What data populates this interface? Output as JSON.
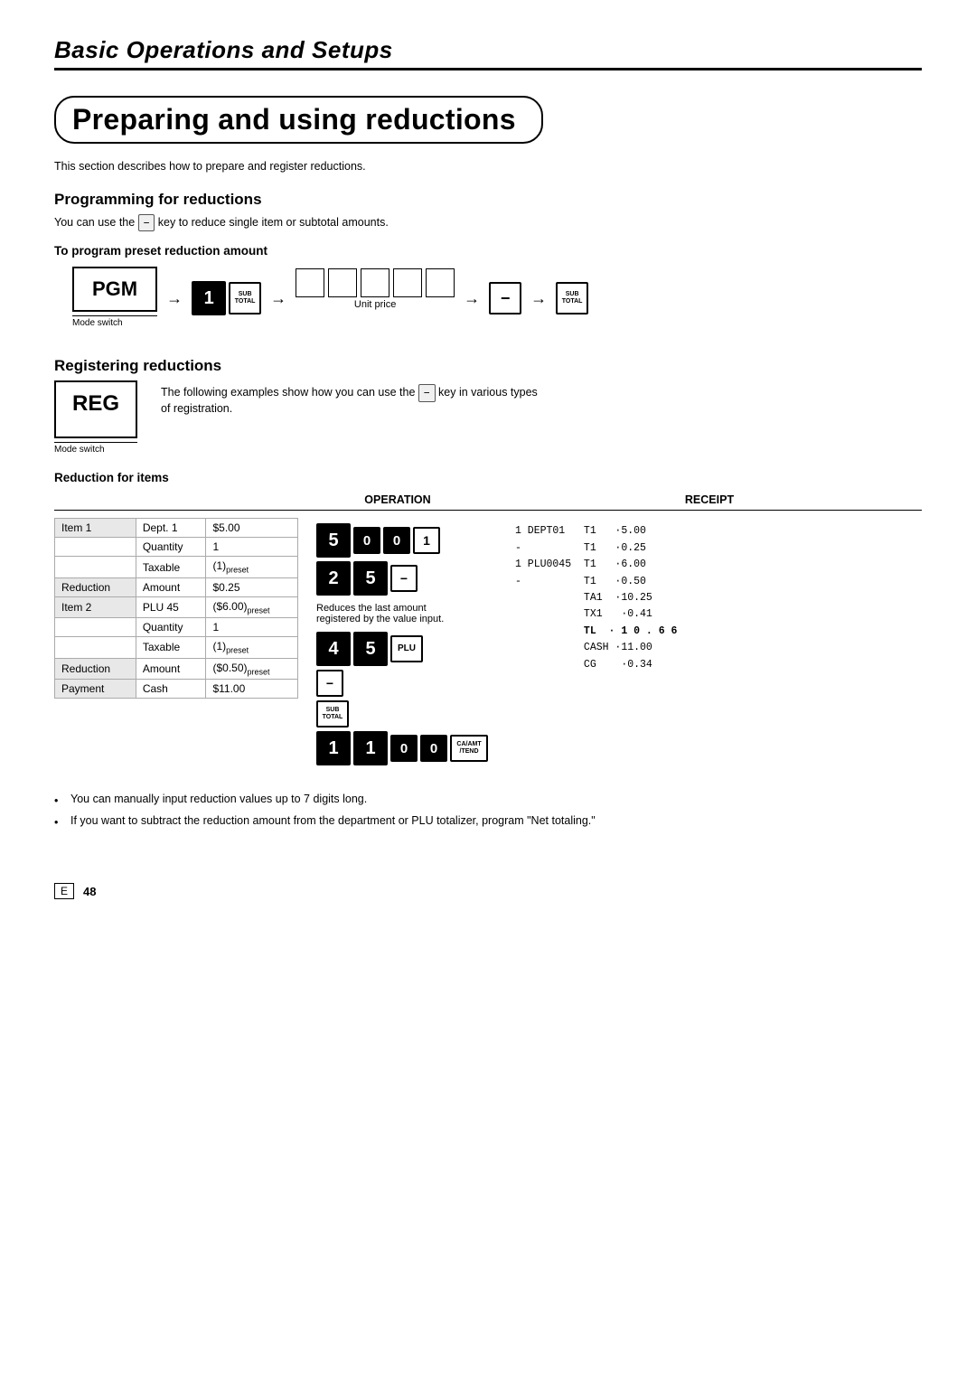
{
  "chapter": {
    "title": "Basic Operations and Setups"
  },
  "page": {
    "title": "Preparing and using reductions",
    "intro": "This section describes how to prepare and register reductions."
  },
  "programming": {
    "heading": "Programming for reductions",
    "body": "You can use the",
    "key_label": "−",
    "body_after": "key to reduce single item or subtotal amounts.",
    "sub_heading": "To program preset reduction amount",
    "pgm_label": "PGM",
    "mode_switch_label": "Mode switch",
    "unit_price_label": "Unit price",
    "key1": "1",
    "sub_total_label": "SUB\nTOTAL"
  },
  "registering": {
    "heading": "Registering reductions",
    "reg_label": "REG",
    "mode_switch_label": "Mode switch",
    "desc": "The following examples show how you can use the",
    "key_label": "−",
    "desc_after": "key in various types of registration.",
    "sub_heading": "Reduction for items",
    "operation_label": "OPERATION",
    "receipt_label": "RECEIPT"
  },
  "table": {
    "rows": [
      {
        "col1": "Item 1",
        "col2": "Dept. 1",
        "col3": "$5.00"
      },
      {
        "col1": "",
        "col2": "Quantity",
        "col3": "1"
      },
      {
        "col1": "",
        "col2": "Taxable",
        "col3": "(1)preset"
      },
      {
        "col1": "Reduction",
        "col2": "Amount",
        "col3": "$0.25"
      },
      {
        "col1": "Item 2",
        "col2": "PLU 45",
        "col3": "($6.00)preset"
      },
      {
        "col1": "",
        "col2": "Quantity",
        "col3": "1"
      },
      {
        "col1": "",
        "col2": "Taxable",
        "col3": "(1)preset"
      },
      {
        "col1": "Reduction",
        "col2": "Amount",
        "col3": "($0.50)preset"
      },
      {
        "col1": "Payment",
        "col2": "Cash",
        "col3": "$11.00"
      }
    ]
  },
  "receipt": {
    "lines": [
      "1 DEPT01   T1    -5.00",
      "-          T1    -0.25",
      "1 PLU0045  T1    -6.00",
      "-          T1    -0.50",
      "           TA1   -10.25",
      "           TX1    -0.41",
      "           TL  - 1 0 . 6 6",
      "           CASH  -11.00",
      "           CG     -0.34"
    ]
  },
  "bullets": [
    "You can manually input reduction values up to 7 digits long.",
    "If you want to subtract the reduction amount from the department or PLU totalizer, program \"Net totaling.\""
  ],
  "footer": {
    "page_marker": "E",
    "page_number": "48"
  }
}
